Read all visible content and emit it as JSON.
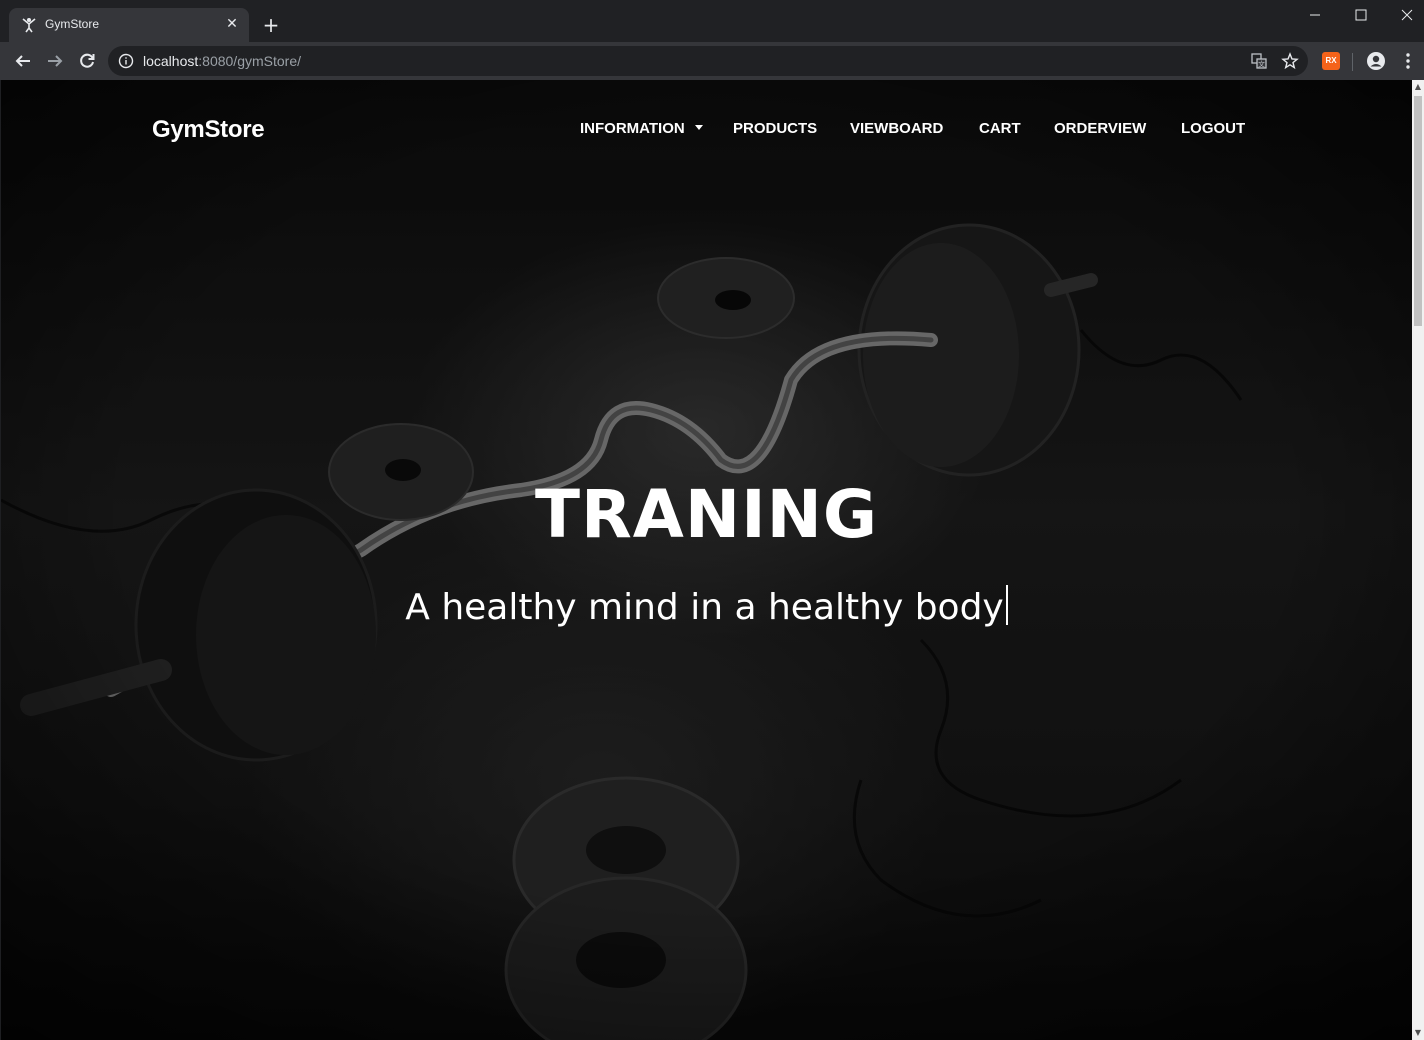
{
  "browser": {
    "tab_title": "GymStore",
    "url_host": "localhost",
    "url_rest": ":8080/gymStore/",
    "extension_badge": "RX"
  },
  "site": {
    "brand": "GymStore",
    "nav": {
      "information": "INFORMATION",
      "products": "PRODUCTS",
      "viewboard": "VIEWBOARD",
      "cart": "CART",
      "orderview": "ORDERVIEW",
      "logout": "LOGOUT"
    }
  },
  "hero": {
    "title": "TRANING",
    "subtitle": "A healthy mind in a healthy body"
  }
}
